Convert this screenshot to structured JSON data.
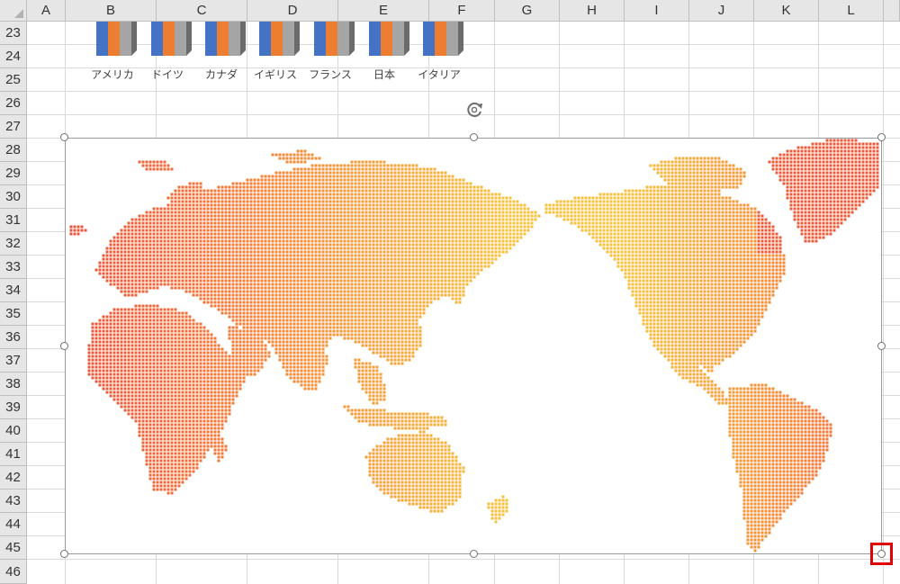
{
  "spreadsheet": {
    "columns": [
      "A",
      "B",
      "C",
      "D",
      "E",
      "F",
      "G",
      "H",
      "I",
      "J",
      "K",
      "L"
    ],
    "rows": [
      "23",
      "24",
      "25",
      "26",
      "27",
      "28",
      "29",
      "30",
      "31",
      "32",
      "33",
      "34",
      "35",
      "36",
      "37",
      "38",
      "39",
      "40",
      "41",
      "42",
      "43",
      "44",
      "45",
      "46"
    ]
  },
  "flags": {
    "colors": [
      "#4472c4",
      "#ed7d31",
      "#a5a5a5"
    ],
    "labels": [
      "アメリカ",
      "ドイツ",
      "カナダ",
      "イギリス",
      "フランス",
      "日本",
      "イタリア"
    ]
  },
  "map_shape": {
    "type": "dotted-world-map",
    "gradient_colors": [
      "#e5533d",
      "#f08a3a",
      "#f6c13f"
    ]
  },
  "selection": {
    "rotate_icon": "rotate-handle-icon",
    "resize_handles": [
      "top-left",
      "top-center",
      "top-right",
      "middle-left",
      "middle-right",
      "bottom-left",
      "bottom-center",
      "bottom-right"
    ],
    "highlight_color": "#e00000"
  }
}
